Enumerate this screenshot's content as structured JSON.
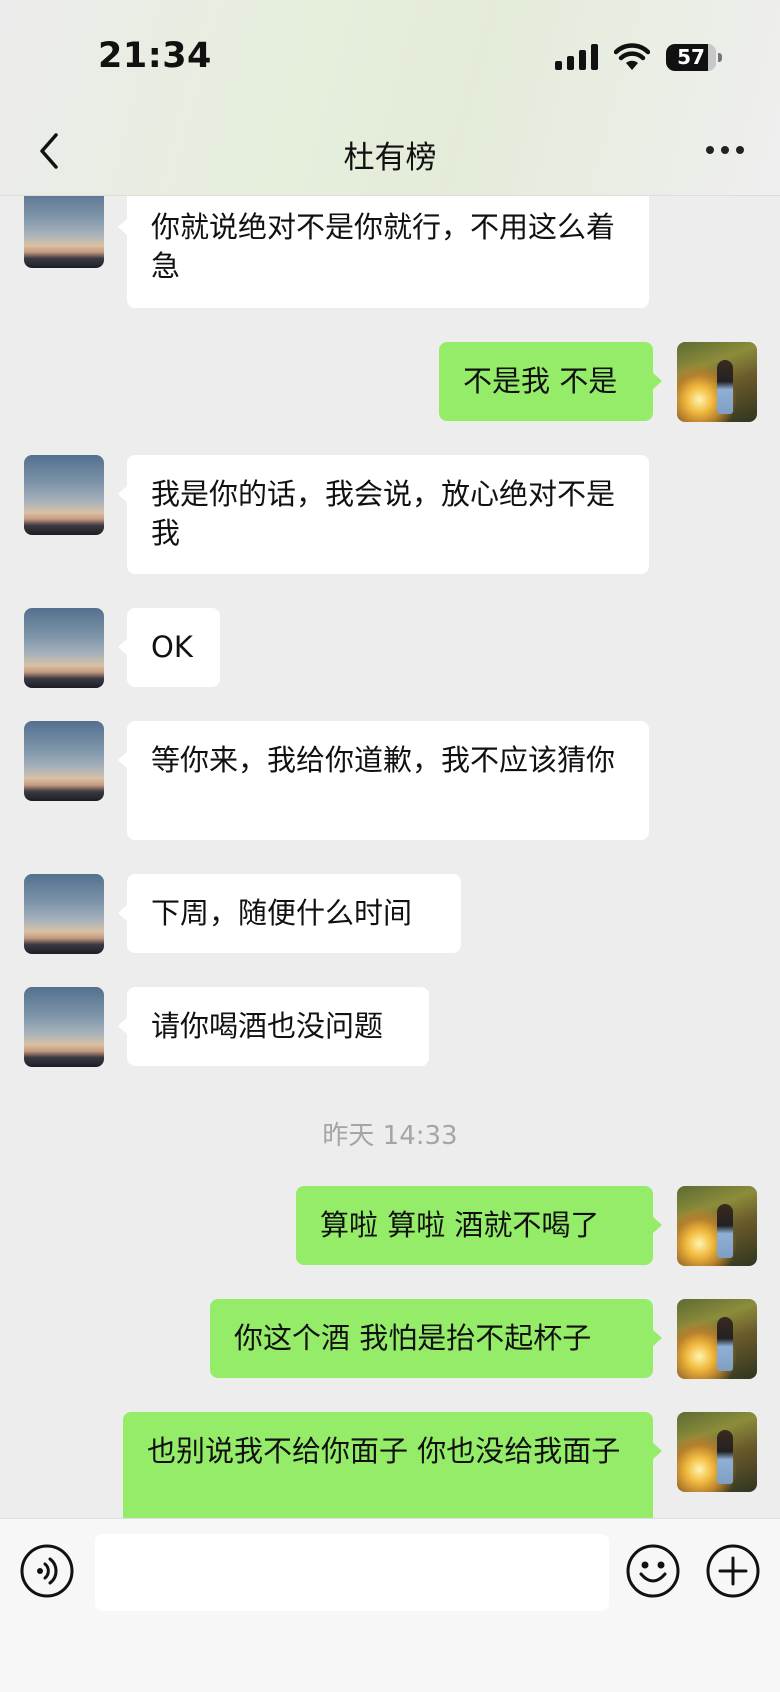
{
  "status_bar": {
    "time": "21:34",
    "battery": "57"
  },
  "header": {
    "title": "杜有榜"
  },
  "messages": [
    {
      "side": "in",
      "text": "你就说绝对不是你就行，不用这么着急"
    },
    {
      "side": "out",
      "text": "不是我 不是"
    },
    {
      "side": "in",
      "text": "我是你的话，我会说，放心绝对不是我"
    },
    {
      "side": "in",
      "text": "OK"
    },
    {
      "side": "in",
      "text": "等你来，我给你道歉，我不应该猜你"
    },
    {
      "side": "in",
      "text": "下周，随便什么时间"
    },
    {
      "side": "in",
      "text": "请你喝酒也没问题"
    },
    {
      "side": "out",
      "text": "算啦 算啦  酒就不喝了"
    },
    {
      "side": "out",
      "text": "你这个酒 我怕是抬不起杯子"
    },
    {
      "side": "out",
      "text": "也别说我不给你面子 你也没给我面子"
    }
  ],
  "timestamp": "昨天 14:33",
  "input": {
    "value": ""
  },
  "icons": [
    "back-icon",
    "more-icon",
    "voice-icon",
    "emoji-icon",
    "plus-icon"
  ],
  "colors": {
    "incoming_bubble": "#ffffff",
    "outgoing_bubble": "#95ec69",
    "background": "#ededed"
  }
}
